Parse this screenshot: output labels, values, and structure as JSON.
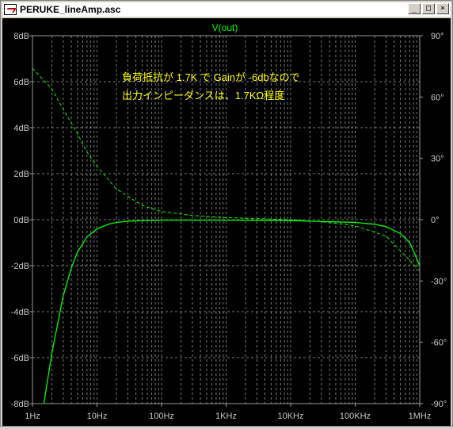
{
  "window": {
    "title": "PERUKE_lineAmp.asc",
    "icons": [
      "waveform-app-icon",
      "minimize-icon",
      "maximize-icon",
      "close-icon"
    ],
    "buttons": {
      "minimize": "_",
      "maximize": "□",
      "close": "×"
    }
  },
  "annotation": {
    "line1": "負荷抵抗が 1.7K で Gainが -6dbなので",
    "line2": "出力インピーダンスは、1.7KΩ程度"
  },
  "colors": {
    "trace": "#00ff00",
    "annotation": "#ffff00",
    "axis_text": "#c8c8c8",
    "grid": "#7a7a7a"
  },
  "chart_data": {
    "type": "line",
    "title": "V(out)",
    "x_scale": "log",
    "xlim": [
      1,
      1000000
    ],
    "x_ticks": [
      {
        "v": 1,
        "label": "1Hz"
      },
      {
        "v": 10,
        "label": "10Hz"
      },
      {
        "v": 100,
        "label": "100Hz"
      },
      {
        "v": 1000,
        "label": "1KHz"
      },
      {
        "v": 10000,
        "label": "10KHz"
      },
      {
        "v": 100000,
        "label": "100KHz"
      },
      {
        "v": 1000000,
        "label": "1MHz"
      }
    ],
    "ylim": [
      -8,
      8
    ],
    "y_ticks": [
      {
        "v": 8,
        "label": "8dB"
      },
      {
        "v": 6,
        "label": "6dB"
      },
      {
        "v": 4,
        "label": "4dB"
      },
      {
        "v": 2,
        "label": "2dB"
      },
      {
        "v": 0,
        "label": "0dB"
      },
      {
        "v": -2,
        "label": "-2dB"
      },
      {
        "v": -4,
        "label": "-4dB"
      },
      {
        "v": -6,
        "label": "-6dB"
      },
      {
        "v": -8,
        "label": "-8dB"
      }
    ],
    "y2lim": [
      -90,
      90
    ],
    "y2_ticks": [
      {
        "v": 90,
        "label": "90°"
      },
      {
        "v": 60,
        "label": "60°"
      },
      {
        "v": 30,
        "label": "30°"
      },
      {
        "v": 0,
        "label": "0°"
      },
      {
        "v": -30,
        "label": "-30°"
      },
      {
        "v": -60,
        "label": "-60°"
      },
      {
        "v": -90,
        "label": "-90°"
      }
    ],
    "grid": true,
    "series": [
      {
        "kind": "magnitude",
        "style": "solid",
        "x": [
          1.5,
          2,
          3,
          4,
          5,
          7,
          10,
          15,
          20,
          30,
          50,
          100,
          1000,
          10000,
          100000,
          200000,
          300000,
          500000,
          700000,
          1000000
        ],
        "y": [
          -8.0,
          -5.8,
          -3.3,
          -2.1,
          -1.4,
          -0.75,
          -0.4,
          -0.2,
          -0.12,
          -0.07,
          -0.04,
          -0.02,
          -0.02,
          -0.04,
          -0.12,
          -0.2,
          -0.3,
          -0.6,
          -1.0,
          -2.0
        ]
      },
      {
        "kind": "phase",
        "style": "dashed",
        "x": [
          1,
          2,
          3,
          5,
          7,
          10,
          20,
          50,
          100,
          300,
          1000,
          3000,
          10000,
          30000,
          100000,
          300000,
          1000000
        ],
        "y": [
          74,
          64,
          54,
          42,
          33,
          26,
          15,
          7,
          4,
          2,
          1,
          0.5,
          0,
          -1,
          -3,
          -8,
          -25
        ]
      }
    ]
  }
}
